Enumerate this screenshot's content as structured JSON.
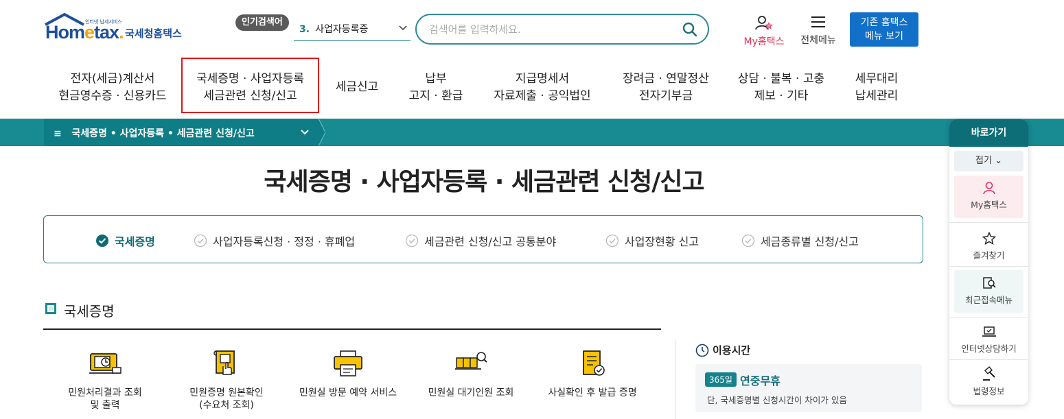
{
  "header": {
    "logo_text": "Hometax",
    "logo_tagline": "인터넷 납세서비스",
    "logo_korean": "국세청홈택스",
    "popular_badge": "인기검색어",
    "popular_rank": "3.",
    "popular_keyword": "사업자등록증",
    "search_placeholder": "검색어를 입력하세요.",
    "my_hometax": "My홈택스",
    "all_menu": "전체메뉴",
    "classic_btn_line1": "기존 홈택스",
    "classic_btn_line2": "메뉴 보기"
  },
  "nav": [
    {
      "line1": "전자(세금)계산서",
      "line2": "현금영수증 · 신용카드"
    },
    {
      "line1": "국세증명 · 사업자등록",
      "line2": "세금관련 신청/신고"
    },
    {
      "line1": "세금신고",
      "line2": ""
    },
    {
      "line1": "납부",
      "line2": "고지 · 환급"
    },
    {
      "line1": "지급명세서",
      "line2": "자료제출 · 공익법인"
    },
    {
      "line1": "장려금 · 연말정산",
      "line2": "전자기부금"
    },
    {
      "line1": "상담 · 불복 · 고충",
      "line2": "제보 · 기타"
    },
    {
      "line1": "세무대리",
      "line2": "납세관리"
    }
  ],
  "breadcrumb": "국세증명 • 사업자등록 • 세금관련 신청/신고",
  "page_title": "국세증명 · 사업자등록 · 세금관련 신청/신고",
  "tabs": [
    {
      "label": "국세증명"
    },
    {
      "label": "사업자등록신청 · 정정 · 휴폐업"
    },
    {
      "label": "세금관련 신청/신고 공통분야"
    },
    {
      "label": "사업장현황 신고"
    },
    {
      "label": "세금종류별 신청/신고"
    }
  ],
  "section_title": "국세증명",
  "services": [
    {
      "line1": "민원처리결과 조회",
      "line2": "및 출력"
    },
    {
      "line1": "민원증명 원본확인",
      "line2": "(수요처 조회)"
    },
    {
      "line1": "민원실 방문 예약 서비스",
      "line2": ""
    },
    {
      "line1": "민원실 대기인원 조회",
      "line2": ""
    },
    {
      "line1": "사실확인 후 발급 증명",
      "line2": ""
    }
  ],
  "hours": {
    "title": "이용시간",
    "badge": "365일",
    "main": "연중무휴",
    "note": "단, 국세증명별 신청시간이 차이가 있음"
  },
  "quick": {
    "title": "바로가기",
    "fold": "접기",
    "items": [
      {
        "label": "My홈택스"
      },
      {
        "label": "즐겨찾기"
      },
      {
        "label": "최근접속메뉴"
      },
      {
        "label": "인터넷상담하기"
      },
      {
        "label": "법령정보"
      }
    ]
  },
  "colors": {
    "teal": "#178a92",
    "accent_red": "#e3131b",
    "brand_blue": "#1270c9",
    "pink": "#e0335b"
  }
}
